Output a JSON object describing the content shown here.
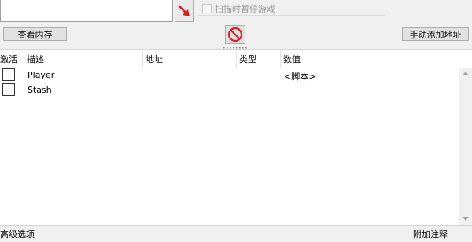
{
  "toolbar": {
    "pause_game_label": "扫描时暂停游戏",
    "view_memory_label": "查看内存",
    "add_address_label": "手动添加地址"
  },
  "table": {
    "columns": [
      "激活",
      "描述",
      "地址",
      "类型",
      "数值"
    ],
    "rows": [
      {
        "active": false,
        "description": "Player",
        "address": "",
        "type": "",
        "value": "<脚本>"
      },
      {
        "active": false,
        "description": "Stash",
        "address": "",
        "type": "",
        "value": ""
      }
    ]
  },
  "statusbar": {
    "advanced_options_label": "高级选项",
    "comments_label": "附加注释"
  },
  "colors": {
    "arrow": "#d42020",
    "stop": "#d42020"
  }
}
